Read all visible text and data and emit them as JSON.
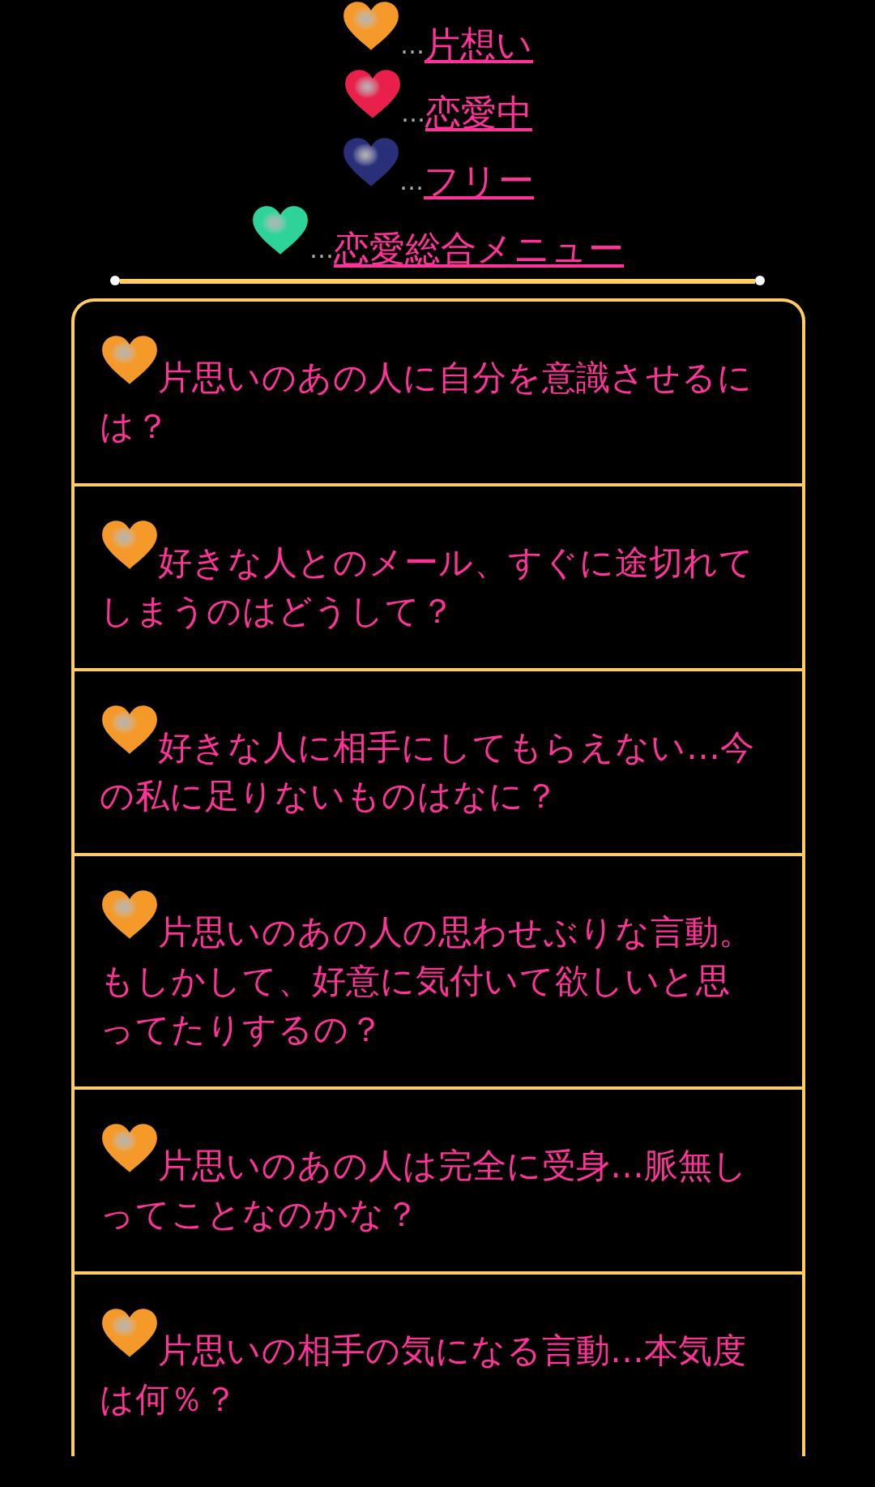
{
  "menu": [
    {
      "lead": "…",
      "label": "片想い",
      "color": "#f59a2a"
    },
    {
      "lead": "…",
      "label": "恋愛中",
      "color": "#e8204a"
    },
    {
      "lead": "…",
      "label": "フリー",
      "color": "#2a2f7a"
    },
    {
      "lead": "…",
      "label": "恋愛総合メニュー",
      "color": "#2ed39a"
    }
  ],
  "articles": [
    {
      "title": "片思いのあの人に自分を意識させるには？",
      "color": "#f59a2a"
    },
    {
      "title": "好きな人とのメール、すぐに途切れてしまうのはどうして？",
      "color": "#f59a2a"
    },
    {
      "title": "好きな人に相手にしてもらえない…今の私に足りないものはなに？",
      "color": "#f59a2a"
    },
    {
      "title": "片思いのあの人の思わせぶりな言動。もしかして、好意に気付いて欲しいと思ってたりするの？",
      "color": "#f59a2a"
    },
    {
      "title": "片思いのあの人は完全に受身…脈無しってことなのかな？",
      "color": "#f59a2a"
    },
    {
      "title": "片思いの相手の気になる言動…本気度は何％？",
      "color": "#f59a2a"
    }
  ]
}
